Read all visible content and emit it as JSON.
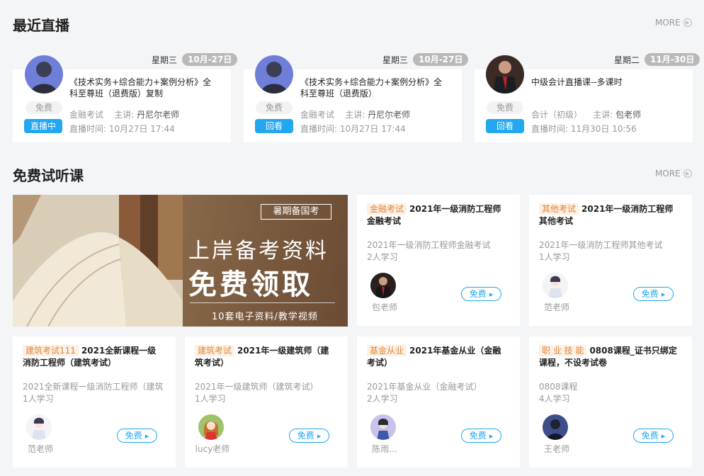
{
  "live": {
    "title": "最近直播",
    "more": "MORE",
    "cards": [
      {
        "day": "星期三",
        "date": "10月-27日",
        "free": "免费",
        "action": "直播中",
        "title": "《技术实务+综合能力+案例分析》全科至尊班（退费版）复制",
        "category": "金融考试",
        "host_label": "主讲:",
        "host": "丹尼尔老师",
        "time_label": "直播时间:",
        "time": "10月27日 17:44"
      },
      {
        "day": "星期三",
        "date": "10月-27日",
        "free": "免费",
        "action": "回看",
        "title": "《技术实务+综合能力+案例分析》全科至尊班（退费版）",
        "category": "金融考试",
        "host_label": "主讲:",
        "host": "丹尼尔老师",
        "time_label": "直播时间:",
        "time": "10月27日 17:44"
      },
      {
        "day": "星期二",
        "date": "11月-30日",
        "free": "免费",
        "action": "回看",
        "title": "中级会计直播课--多课时",
        "category": "会计（初级）",
        "host_label": "主讲:",
        "host": "包老师",
        "time_label": "直播时间:",
        "time": "11月30日 10:56"
      }
    ]
  },
  "trial": {
    "title": "免费试听课",
    "more": "MORE",
    "banner": {
      "badge": "暑期备国考",
      "line1": "上岸备考资料",
      "line2": "免费领取",
      "line3": "10套电子资料/教学视频"
    },
    "courses": [
      {
        "tag": "金融考试",
        "title": "2021年一级消防工程师金融考试",
        "sub": "2021年一级消防工程师金融考试",
        "count": "2人学习",
        "teacher": "包老师",
        "free": "免费"
      },
      {
        "tag": "其他考试",
        "title": "2021年一级消防工程师其他考试",
        "sub": "2021年一级消防工程师其他考试",
        "count": "1人学习",
        "teacher": "范老师",
        "free": "免费"
      },
      {
        "tag": "建筑考试111",
        "title": "2021全新课程一级消防工程师（建筑考试）",
        "sub": "2021全新课程一级消防工程师（建筑",
        "count": "1人学习",
        "teacher": "范老师",
        "free": "免费"
      },
      {
        "tag": "建筑考试",
        "title": "2021年一级建筑师（建筑考试）",
        "sub": "2021年一级建筑师（建筑考试）",
        "count": "1人学习",
        "teacher": "lucy老师",
        "free": "免费"
      },
      {
        "tag": "基金从业",
        "title": "2021年基金从业（金融考试）",
        "sub": "2021年基金从业（金融考试）",
        "count": "2人学习",
        "teacher": "陈雨...",
        "free": "免费"
      },
      {
        "tag": "职 业 技 能",
        "title": "0808课程_证书只绑定课程，不设考试卷",
        "sub": "0808课程",
        "count": "4人学习",
        "teacher": "王老师",
        "free": "免费"
      }
    ]
  },
  "colors": {
    "accent": "#22a7f0",
    "tag_orange": "#e2883a",
    "date_pill": "#b9b9b9"
  }
}
